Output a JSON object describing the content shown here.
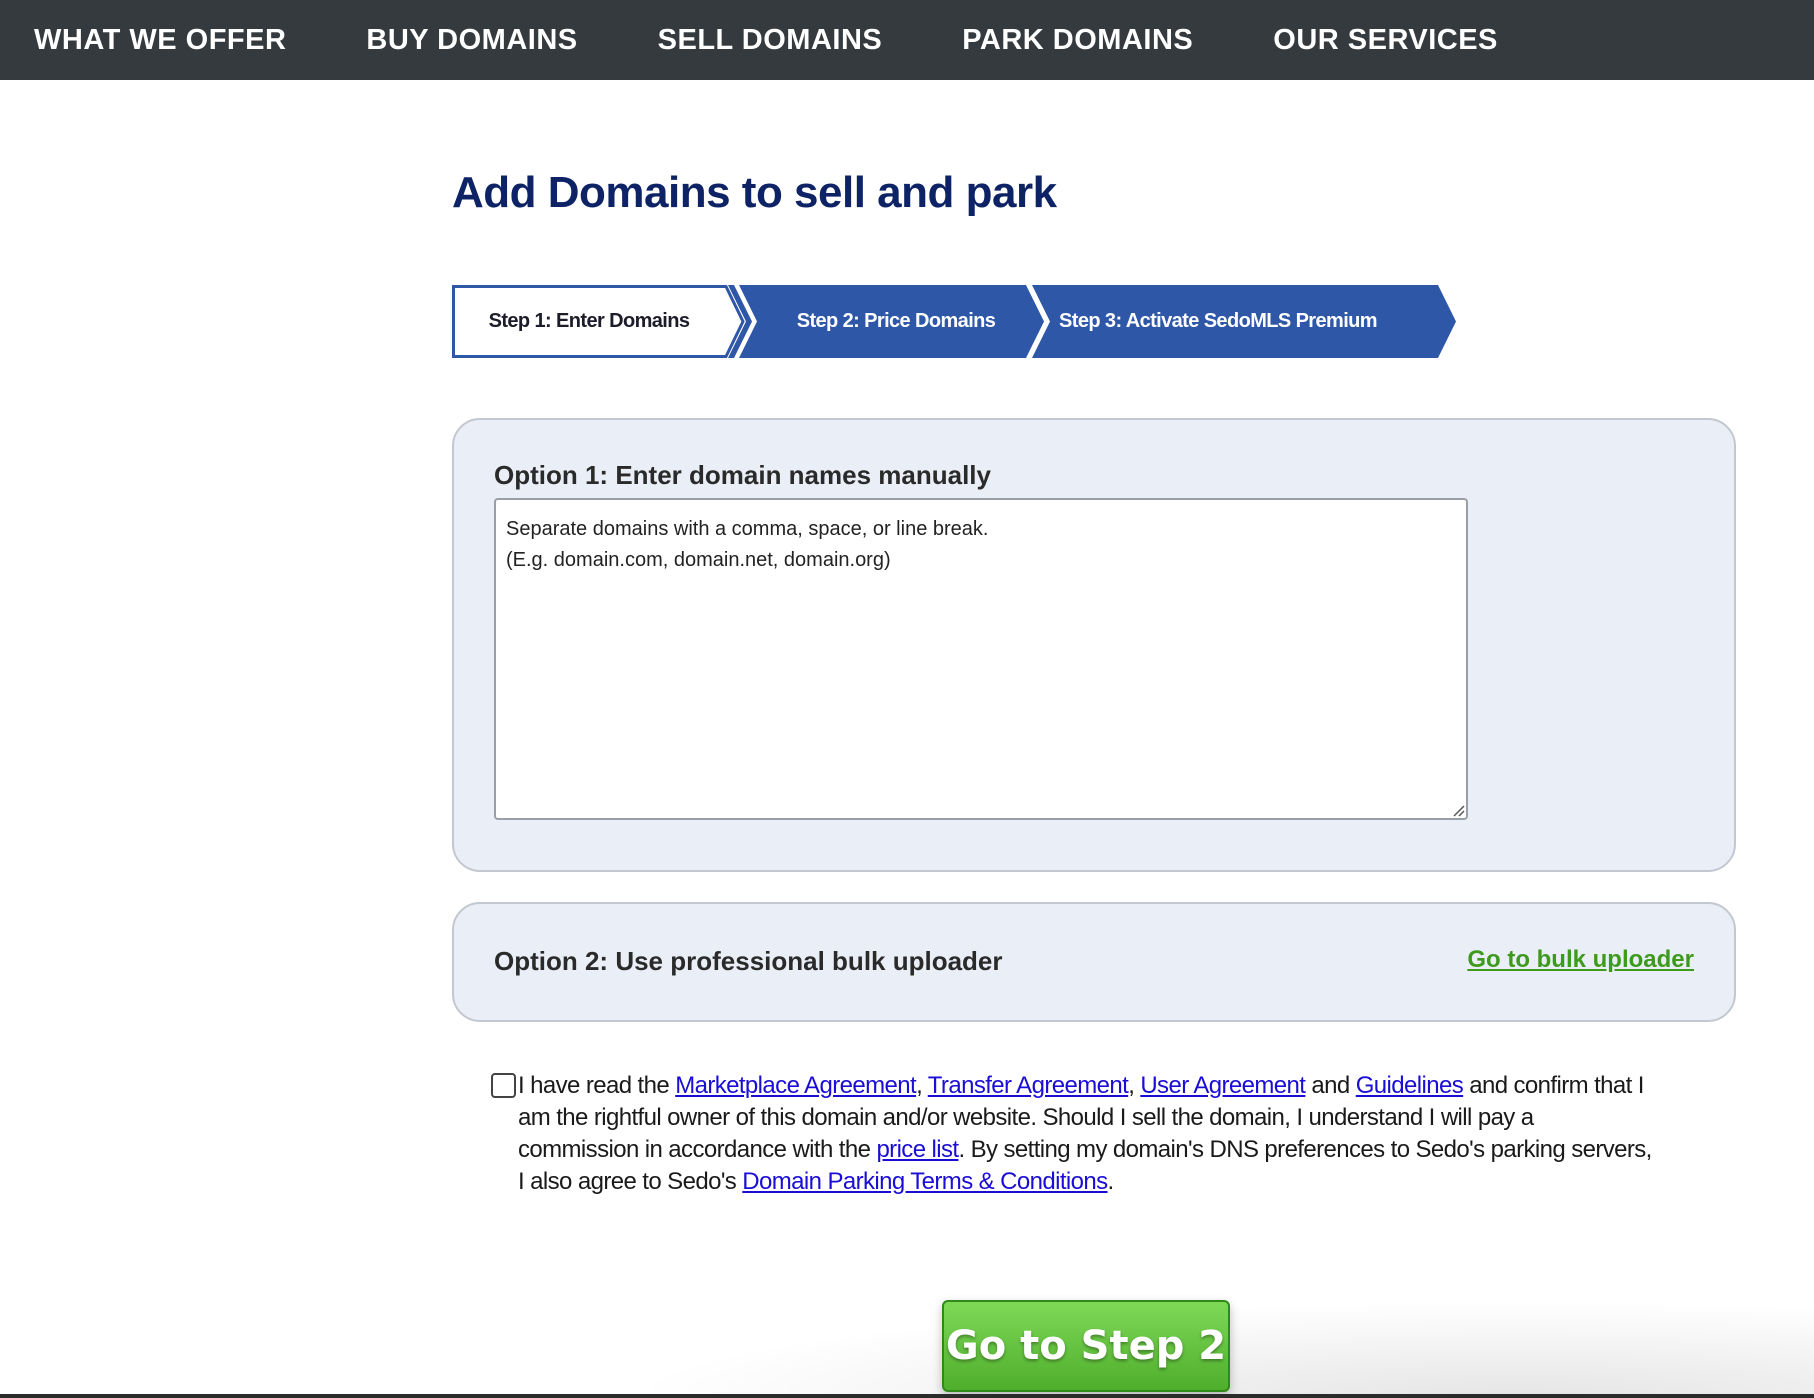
{
  "nav": {
    "items": [
      {
        "label": "WHAT WE OFFER"
      },
      {
        "label": "BUY DOMAINS"
      },
      {
        "label": "SELL DOMAINS"
      },
      {
        "label": "PARK DOMAINS"
      },
      {
        "label": "OUR SERVICES"
      }
    ]
  },
  "page": {
    "title": "Add Domains to sell and park"
  },
  "steps": {
    "current": 1,
    "items": [
      {
        "label": "Step 1: Enter Domains"
      },
      {
        "label": "Step 2: Price Domains"
      },
      {
        "label": "Step 3: Activate SedoMLS Premium"
      }
    ]
  },
  "option1": {
    "label": "Option 1: Enter domain names manually",
    "value": "",
    "placeholder": "Separate domains with a comma, space, or line break.\n(E.g. domain.com, domain.net, domain.org)"
  },
  "option2": {
    "label": "Option 2: Use professional bulk uploader",
    "link": "Go to bulk uploader"
  },
  "agreement": {
    "checked": false,
    "t1": "I have read the ",
    "link_marketplace": "Marketplace Agreement",
    "t2": ", ",
    "link_transfer": "Transfer Agreement",
    "t3": ", ",
    "link_user": "User Agreement",
    "t4": " and ",
    "link_guidelines": "Guidelines",
    "t5": " and confirm that I am the rightful owner of this domain and/or website. Should I sell the domain, I understand I will pay a commission in accordance with the ",
    "link_price": "price list",
    "t6": ". By setting my domain's DNS preferences to Sedo's parking servers, I also agree to Sedo's ",
    "link_parking": "Domain Parking Terms & Conditions",
    "t7": "."
  },
  "actions": {
    "next_label": "Go to Step 2"
  },
  "colors": {
    "nav_bg": "#343a3e",
    "title": "#0d2366",
    "step_active_border": "#2f57a8",
    "step_inactive_bg": "#2f57a8",
    "panel_bg": "#eaeff7",
    "link": "#1a0dd6",
    "bulk_link": "#3d9a1c",
    "button_green": "#5fbe3a"
  }
}
